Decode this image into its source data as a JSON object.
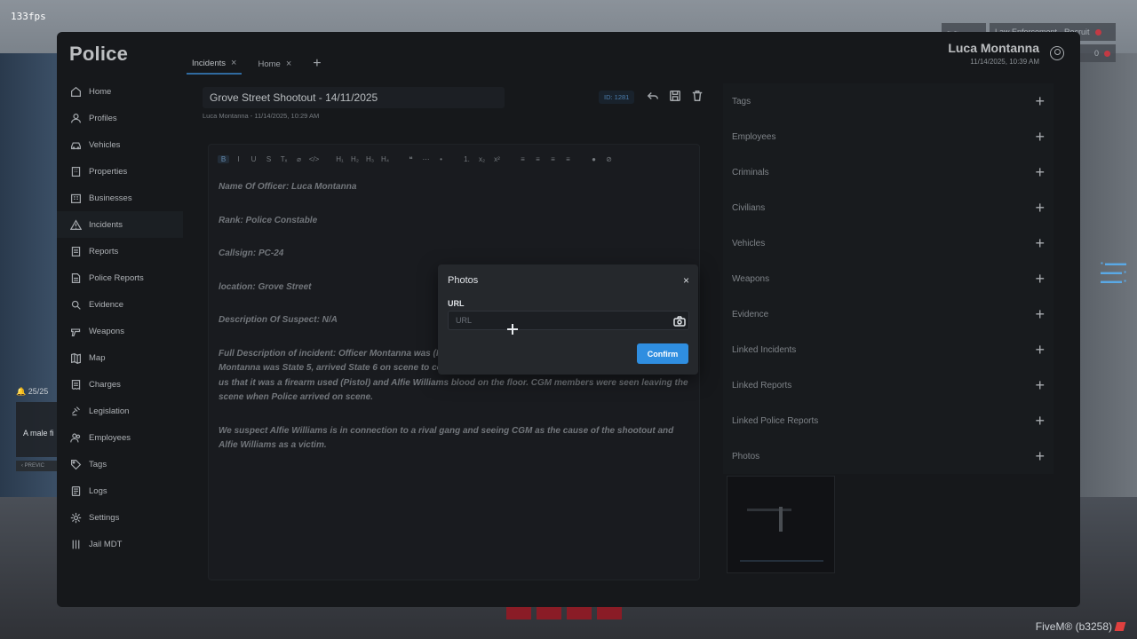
{
  "overlay": {
    "fps": "133fps",
    "fivem": "FiveM® (b3258)",
    "notification": {
      "count": "25/25",
      "text": "A male fi",
      "prev": "PREVIC"
    },
    "hud": {
      "top_left": "~ ~",
      "top_right": "Law Enforcement - Recruit",
      "counter": "0"
    }
  },
  "app": {
    "brand": "Police",
    "user": {
      "name": "Luca Montanna",
      "timestamp": "11/14/2025, 10:39 AM"
    },
    "tabs": [
      {
        "label": "Incidents",
        "active": true
      },
      {
        "label": "Home",
        "active": false
      }
    ],
    "sidebar": {
      "items": [
        {
          "label": "Home",
          "icon": "home-icon"
        },
        {
          "label": "Profiles",
          "icon": "user-icon"
        },
        {
          "label": "Vehicles",
          "icon": "car-icon"
        },
        {
          "label": "Properties",
          "icon": "building-icon"
        },
        {
          "label": "Businesses",
          "icon": "office-icon"
        },
        {
          "label": "Incidents",
          "icon": "warning-icon",
          "active": true
        },
        {
          "label": "Reports",
          "icon": "report-icon"
        },
        {
          "label": "Police Reports",
          "icon": "document-icon"
        },
        {
          "label": "Evidence",
          "icon": "magnifier-icon"
        },
        {
          "label": "Weapons",
          "icon": "gun-icon"
        },
        {
          "label": "Map",
          "icon": "map-icon"
        },
        {
          "label": "Charges",
          "icon": "receipt-icon"
        },
        {
          "label": "Legislation",
          "icon": "gavel-icon"
        },
        {
          "label": "Employees",
          "icon": "people-icon"
        },
        {
          "label": "Tags",
          "icon": "tag-icon"
        },
        {
          "label": "Logs",
          "icon": "logs-icon"
        },
        {
          "label": "Settings",
          "icon": "gear-icon"
        },
        {
          "label": "Jail MDT",
          "icon": "bars-icon"
        }
      ]
    },
    "incident": {
      "title": "Grove Street Shootout - 14/11/2025",
      "subtitle": "Luca Montanna - 11/14/2025, 10:29 AM",
      "id": "ID: 1281",
      "toolbar": [
        "B",
        "I",
        "U",
        "S",
        "Tₓ",
        "⌀",
        "</>",
        "H₁",
        "H₂",
        "H₃",
        "H₄",
        "❝",
        "⋯",
        "•",
        "1.",
        "x₂",
        "x²",
        "≡",
        "≡",
        "≡",
        "≡",
        "●",
        "⊘"
      ],
      "paragraphs": [
        "Name Of Officer: Luca Montanna",
        "Rank: Police Constable",
        "Callsign: PC-24",
        "location: Grove Street",
        "Description Of Suspect: N/A",
        "Full Description of incident: Officer Montanna was (PPC) that a shootout was in place in Grove Street. Officer Montanna was State 5, arrived State 6 on scene to collect blood and bullet casings. After testing it was known to us that it was a firearm used (Pistol) and Alfie Williams blood on the floor. CGM members were seen leaving the scene when Police arrived on scene.",
        "We suspect Alfie Williams is in connection to a rival gang and seeing CGM as the cause of the shootout and Alfie Williams as a victim."
      ]
    },
    "sections": [
      "Tags",
      "Employees",
      "Criminals",
      "Civilians",
      "Vehicles",
      "Weapons",
      "Evidence",
      "Linked Incidents",
      "Linked Reports",
      "Linked Police Reports",
      "Photos"
    ],
    "modal": {
      "title": "Photos",
      "close": "×",
      "label": "URL",
      "placeholder": "URL",
      "confirm": "Confirm"
    }
  }
}
